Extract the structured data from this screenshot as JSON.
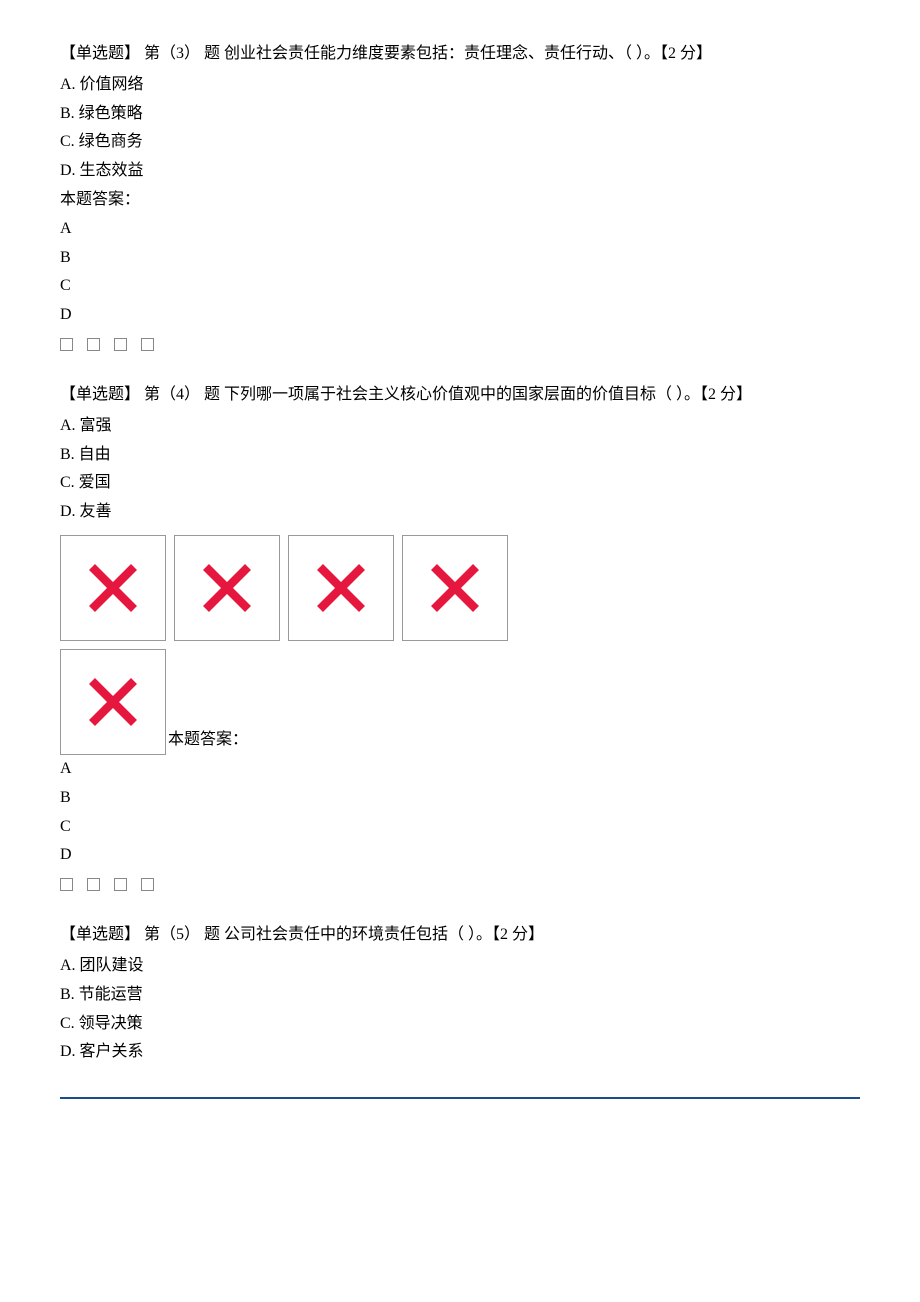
{
  "questions": [
    {
      "prefix": "【单选题】 第（3） 题 创业社会责任能力维度要素包括：责任理念、责任行动、（ ）。【2 分】",
      "options": [
        "A. 价值网络",
        "B. 绿色策略",
        "C. 绿色商务",
        "D. 生态效益"
      ],
      "answerLabel": "本题答案：",
      "answerLetters": [
        "A",
        "B",
        "C",
        "D"
      ]
    },
    {
      "prefix": "【单选题】 第（4） 题 下列哪一项属于社会主义核心价值观中的国家层面的价值目标（ ）。【2 分】",
      "options": [
        "A. 富强",
        "B. 自由",
        "C. 爱国",
        "D. 友善"
      ],
      "answerLabel": "本题答案：",
      "answerLetters": [
        "A",
        "B",
        "C",
        "D"
      ],
      "xBoxCount": 5
    },
    {
      "prefix": "【单选题】 第（5） 题 公司社会责任中的环境责任包括（ ）。【2 分】",
      "options": [
        "A. 团队建设",
        "B. 节能运营",
        "C. 领导决策",
        "D. 客户关系"
      ]
    }
  ]
}
